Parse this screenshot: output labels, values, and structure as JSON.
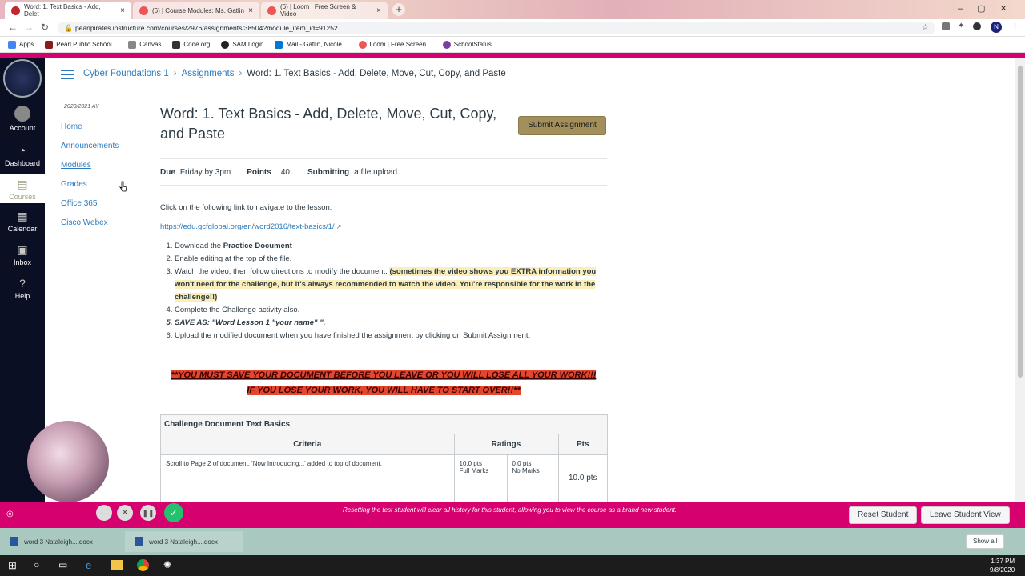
{
  "browser": {
    "tabs": [
      {
        "label": "Word: 1. Text Basics - Add, Delet",
        "active": true
      },
      {
        "label": "(6) | Course Modules: Ms. Gatlin",
        "active": false
      },
      {
        "label": "(6) | Loom | Free Screen & Video",
        "active": false
      }
    ],
    "url": "pearlpirates.instructure.com/courses/2976/assignments/38504?module_item_id=91252",
    "bookmarks": [
      "Apps",
      "Pearl Public School...",
      "Canvas",
      "Code.org",
      "SAM Login",
      "Mail - Gatlin, Nicole...",
      "Loom | Free Screen...",
      "SchoolStatus"
    ]
  },
  "global_nav": {
    "items": [
      "Account",
      "Dashboard",
      "Courses",
      "Calendar",
      "Inbox",
      "Help"
    ]
  },
  "breadcrumb": {
    "course": "Cyber Foundations 1",
    "section": "Assignments",
    "current": "Word: 1. Text Basics - Add, Delete, Move, Cut, Copy, and Paste"
  },
  "course_nav": {
    "term": "2020/2021 AY",
    "items": [
      "Home",
      "Announcements",
      "Modules",
      "Grades",
      "Office 365",
      "Cisco Webex"
    ]
  },
  "assignment": {
    "title": "Word: 1. Text Basics - Add, Delete, Move, Cut, Copy, and Paste",
    "submit_label": "Submit Assignment",
    "due_label": "Due",
    "due_value": "Friday by 3pm",
    "points_label": "Points",
    "points_value": "40",
    "submitting_label": "Submitting",
    "submitting_value": "a file upload",
    "intro": "Click on the following link to navigate to the lesson:",
    "link": "https://edu.gcfglobal.org/en/word2016/text-basics/1/",
    "steps": {
      "s1_pre": "Download the ",
      "s1_bold": "Practice Document",
      "s2": "Enable editing at the top of the file.",
      "s3_pre": "Watch the video, then follow directions to modify the document. ",
      "s3_hl": "(sometimes the video shows you EXTRA information you won't need for the challenge, but it's always recommended to watch the video. You're responsible for the work in the challenge!!)",
      "s4": "Complete the Challenge activity also.",
      "s5": "SAVE AS:  \"Word Lesson 1 \"your name\" \".",
      "s6": "Upload the modified document when you have finished the assignment by clicking on Submit Assignment."
    },
    "warning": "**YOU MUST SAVE YOUR DOCUMENT BEFORE YOU LEAVE OR YOU WILL LOSE ALL YOUR WORK!!! IF YOU LOSE YOUR WORK, YOU WILL HAVE TO START OVER!!**"
  },
  "rubric": {
    "title": "Challenge Document Text Basics",
    "headers": [
      "Criteria",
      "Ratings",
      "Pts"
    ],
    "row1": {
      "criteria": "Scroll to Page 2 of document. 'Now Introducing...' added to top of document.",
      "r1_pts": "10.0 pts",
      "r1_label": "Full Marks",
      "r2_pts": "0.0 pts",
      "r2_label": "No Marks",
      "pts": "10.0 pts"
    }
  },
  "student_view": {
    "message": "Resetting the test student will clear all history for this student, allowing you to view the course as a brand new student.",
    "reset_label": "Reset Student",
    "leave_label": "Leave Student View"
  },
  "downloads": {
    "items": [
      "word 3 Nataleigh....docx",
      "word 3 Nataleigh....docx"
    ],
    "show_all": "Show all"
  },
  "taskbar": {
    "time": "1:37 PM",
    "date": "9/8/2020"
  }
}
